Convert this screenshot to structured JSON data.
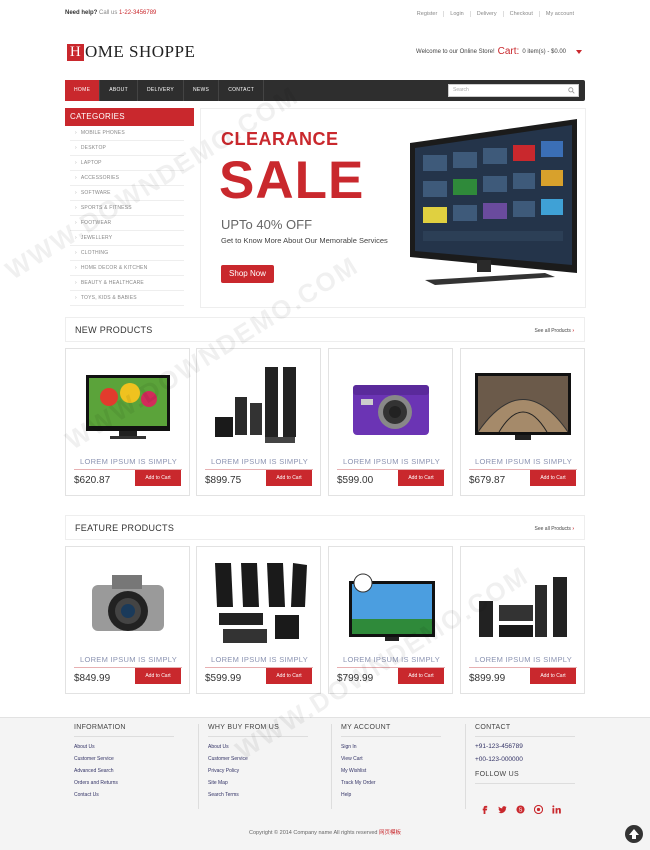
{
  "topbar": {
    "help_label": "Need help?",
    "call_label": "Call us",
    "phone": "1-22-3456789",
    "links": [
      "Register",
      "Login",
      "Delivery",
      "Checkout",
      "My account"
    ]
  },
  "header": {
    "logo_letter": "H",
    "logo_rest": "OME SHOPPE",
    "welcome": "Welcome to our Online Store!",
    "cart_label": "Cart:",
    "cart_summary": "0 item(s) - $0.00"
  },
  "nav": {
    "items": [
      "HOME",
      "ABOUT",
      "DELIVERY",
      "NEWS",
      "CONTACT"
    ],
    "search_placeholder": "Search"
  },
  "sidebar": {
    "title": "CATEGORIES",
    "items": [
      "MOBILE PHONES",
      "DESKTOP",
      "LAPTOP",
      "ACCESSORIES",
      "SOFTWARE",
      "SPORTS & FITNESS",
      "FOOTWEAR",
      "JEWELLERY",
      "CLOTHING",
      "HOME DECOR & KITCHEN",
      "BEAUTY & HEALTHCARE",
      "TOYS, KIDS & BABIES"
    ]
  },
  "banner": {
    "line1": "CLEARANCE",
    "line2": "SALE",
    "offer": "UPTo 40% OFF",
    "text": "Get to Know More About Our Memorable Services",
    "button": "Shop Now"
  },
  "new_products": {
    "title": "NEW PRODUCTS",
    "see_all": "See all Products",
    "items": [
      {
        "name": "LOREM IPSUM IS SIMPLY",
        "price": "$620.87",
        "button": "Add to Cart",
        "icon": "tv-flowers"
      },
      {
        "name": "LOREM IPSUM IS SIMPLY",
        "price": "$899.75",
        "button": "Add to Cart",
        "icon": "home-theater"
      },
      {
        "name": "LOREM IPSUM IS SIMPLY",
        "price": "$599.00",
        "button": "Add to Cart",
        "icon": "camera-purple"
      },
      {
        "name": "LOREM IPSUM IS SIMPLY",
        "price": "$679.87",
        "button": "Add to Cart",
        "icon": "tv-dome"
      }
    ]
  },
  "feature_products": {
    "title": "FEATURE PRODUCTS",
    "see_all": "See all Products",
    "items": [
      {
        "name": "LOREM IPSUM IS SIMPLY",
        "price": "$849.99",
        "button": "Add to Cart",
        "icon": "dslr-camera"
      },
      {
        "name": "LOREM IPSUM IS SIMPLY",
        "price": "$599.99",
        "button": "Add to Cart",
        "icon": "speaker-set"
      },
      {
        "name": "LOREM IPSUM IS SIMPLY",
        "price": "$799.99",
        "button": "Add to Cart",
        "icon": "tv-soccer"
      },
      {
        "name": "LOREM IPSUM IS SIMPLY",
        "price": "$899.99",
        "button": "Add to Cart",
        "icon": "home-theater"
      }
    ]
  },
  "footer": {
    "information": {
      "title": "INFORMATION",
      "links": [
        "About Us",
        "Customer Service",
        "Advanced Search",
        "Orders and Returns",
        "Contact Us"
      ]
    },
    "why": {
      "title": "WHY BUY FROM US",
      "links": [
        "About Us",
        "Customer Service",
        "Privacy Policy",
        "Site Map",
        "Search Terms"
      ]
    },
    "account": {
      "title": "MY ACCOUNT",
      "links": [
        "Sign In",
        "View Cart",
        "My Wishlist",
        "Track My Order",
        "Help"
      ]
    },
    "contact": {
      "title": "CONTACT",
      "phones": [
        "+91-123-456789",
        "+00-123-000000"
      ],
      "follow": "FOLLOW US"
    },
    "copyright": "Copyright © 2014 Company name All rights reserved",
    "copyright_link": "网页模板"
  },
  "watermark": "WWW.DOWNDEMO.COM",
  "colors": {
    "accent": "#c9282d",
    "nav": "#2e2e2e",
    "product_name": "#8b93b1"
  }
}
